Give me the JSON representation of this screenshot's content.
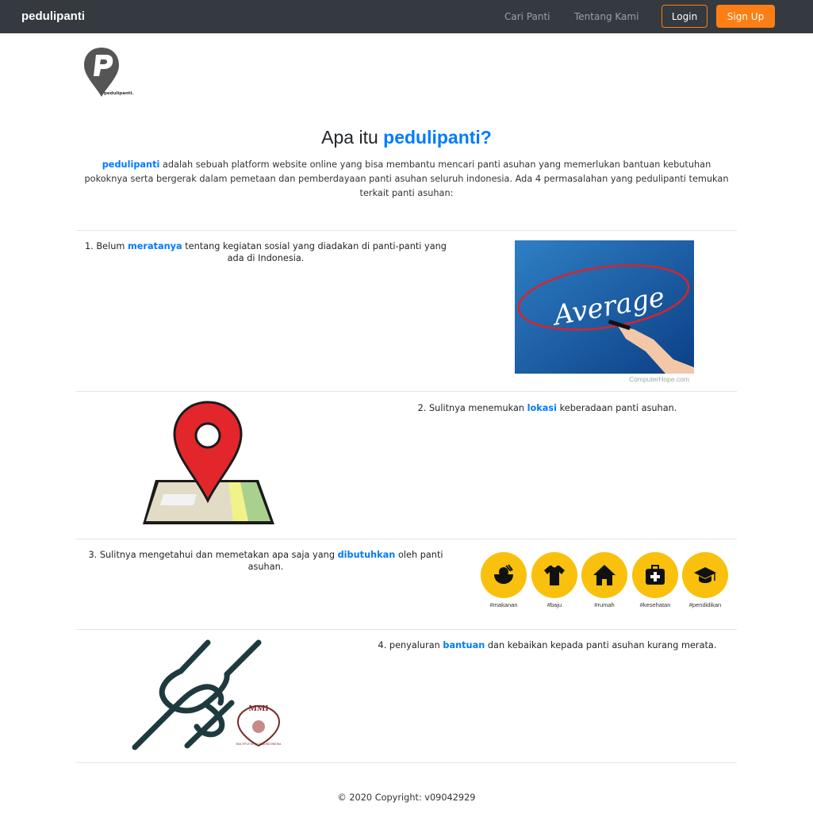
{
  "nav": {
    "brand": "pedulipanti",
    "links": [
      "Cari Panti",
      "Tentang Kami"
    ],
    "login": "Login",
    "signup": "Sign Up"
  },
  "logo": {
    "text": "pedulipanti."
  },
  "hero": {
    "title_prefix": "Apa itu ",
    "title_accent": "pedulipanti?",
    "intro_accent": "pedulipanti",
    "intro_rest": " adalah sebuah platform website online yang bisa membantu mencari panti asuhan yang memerlukan bantuan kebutuhan pokoknya serta bergerak dalam pemetaan dan pemberdayaan panti asuhan seluruh indonesia. Ada 4 permasalahan yang pedulipanti temukan terkait panti asuhan:"
  },
  "items": [
    {
      "before": "1. Belum ",
      "link": "meratanya",
      "after": " tentang kegiatan sosial yang diadakan di panti-panti yang ada di Indonesia."
    },
    {
      "before": "2. Sulitnya menemukan ",
      "link": "lokasi",
      "after": " keberadaan panti asuhan."
    },
    {
      "before": "3. Sulitnya mengetahui dan memetakan apa saja yang ",
      "link": "dibutuhkan",
      "after": " oleh panti asuhan."
    },
    {
      "before": "4. penyaluran ",
      "link": "bantuan",
      "after": " dan kebaikan kepada panti asuhan kurang merata."
    }
  ],
  "image1": {
    "word": "Average",
    "credit": "ComputerHope.com"
  },
  "needs": [
    "#makanan",
    "#baju",
    "#rumah",
    "#kesehatan",
    "#pendidikan"
  ],
  "image4": {
    "badge": "MMI",
    "badge_sub": "MULTIPLE MYELOMA INDONESIA"
  },
  "footer": "© 2020 Copyright: v09042929",
  "colors": {
    "navbar": "#343a40",
    "accent": "#007bff",
    "orange": "#fd7e14",
    "yellow": "#f9c10d"
  }
}
